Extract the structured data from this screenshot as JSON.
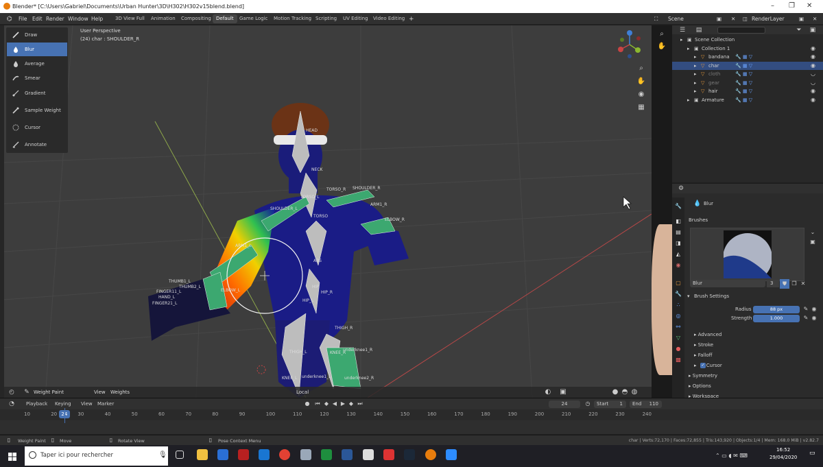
{
  "window": {
    "title": "Blender* [C:\\Users\\Gabriel\\Documents\\Urban Hunter\\3D\\H302\\H302v15blend.blend]"
  },
  "menu": [
    "File",
    "Edit",
    "Render",
    "Window",
    "Help"
  ],
  "workspaces": [
    "3D View Full",
    "Animation",
    "Compositing",
    "Default",
    "Game Logic",
    "Motion Tracking",
    "Scripting",
    "UV Editing",
    "Video Editing"
  ],
  "active_workspace": "Default",
  "scene_label": "Scene",
  "view_layer": "RenderLayer",
  "tools": [
    {
      "label": "Draw",
      "icon": "draw-brush-icon"
    },
    {
      "label": "Blur",
      "icon": "blur-drop-icon"
    },
    {
      "label": "Average",
      "icon": "average-drop-icon"
    },
    {
      "label": "Smear",
      "icon": "smear-icon"
    },
    {
      "label": "Gradient",
      "icon": "gradient-icon"
    },
    {
      "label": "Sample Weight",
      "icon": "eyedropper-icon"
    },
    {
      "label": "Cursor",
      "icon": "cursor-icon"
    },
    {
      "label": "Annotate",
      "icon": "annotate-icon"
    }
  ],
  "active_tool": "Blur",
  "viewport": {
    "perspective": "User Perspective",
    "active_info": "(24) char : SHOULDER_R",
    "header": {
      "mode": "Weight Paint",
      "view": "View",
      "weights": "Weights",
      "orientation": "Local"
    },
    "bone_labels": [
      "HEAD",
      "NECK",
      "TORSO_L",
      "TORSO_R",
      "SHOULDER_R",
      "SHOULDER_L",
      "ARM1_R",
      "ARM1_L",
      "TORSO",
      "ABS",
      "HIP",
      "HIP_R",
      "HIP_L",
      "ELBOW_L",
      "ELBOW_R",
      "THIGH_R",
      "THIGH_L",
      "KNEE_R",
      "KNEE_L",
      "underknee1_R",
      "underknee1_L",
      "underknee2_R",
      "THUMB1_L",
      "THUMB2_L",
      "FINGER11_L",
      "FINGER21_L",
      "HAND_L"
    ]
  },
  "outliner": {
    "search_placeholder": "",
    "rows": [
      {
        "label": "Scene Collection",
        "dim": false,
        "selected": false,
        "indent": 0
      },
      {
        "label": "Collection 1",
        "dim": false,
        "selected": false,
        "indent": 1
      },
      {
        "label": "bandana",
        "dim": false,
        "selected": false,
        "indent": 2
      },
      {
        "label": "char",
        "dim": false,
        "selected": true,
        "indent": 2
      },
      {
        "label": "cloth",
        "dim": true,
        "selected": false,
        "indent": 2
      },
      {
        "label": "gear",
        "dim": true,
        "selected": false,
        "indent": 2
      },
      {
        "label": "hair",
        "dim": false,
        "selected": false,
        "indent": 2
      },
      {
        "label": "Armature",
        "dim": false,
        "selected": false,
        "indent": 1
      }
    ]
  },
  "properties": {
    "tool_name": "Blur",
    "brushes_section": "Brushes",
    "brush_name": "Blur",
    "brush_users": "3",
    "brush_settings_section": "Brush Settings",
    "radius_label": "Radius",
    "radius_value": "88 px",
    "strength_label": "Strength",
    "strength_value": "1.000",
    "strength_fill": 1.0,
    "subsections": [
      "Advanced",
      "Stroke",
      "Falloff",
      "Cursor"
    ],
    "cursor_checked": true,
    "panels": [
      "Symmetry",
      "Options",
      "Workspace"
    ]
  },
  "timeline": {
    "menus": [
      "Playback",
      "Keying",
      "View",
      "Marker"
    ],
    "current_frame": "24",
    "start_label": "Start",
    "start_value": "1",
    "end_label": "End",
    "end_value": "110",
    "ticks": [
      "10",
      "20",
      "30",
      "40",
      "50",
      "60",
      "70",
      "80",
      "90",
      "100",
      "110",
      "120",
      "130",
      "140",
      "150",
      "160",
      "170",
      "180",
      "190",
      "200",
      "210",
      "220",
      "230",
      "240"
    ]
  },
  "statusbar": {
    "left": [
      "Weight Paint",
      "Move",
      "Rotate View",
      "Pose Context Menu"
    ],
    "right": "char | Verts:72,170 | Faces:72,855 | Tris:143,920 | Objects:1/4 | Mem: 168.0 MiB | v2.82.7"
  },
  "taskbar": {
    "search_placeholder": "Taper ici pour rechercher",
    "time": "16:52",
    "date": "29/04/2020"
  },
  "colors": {
    "accent": "#4772b3",
    "selection_row": "#334d80",
    "x_axis": "#c94444",
    "y_axis": "#8bb82f",
    "z_axis": "#3f7fd6"
  }
}
